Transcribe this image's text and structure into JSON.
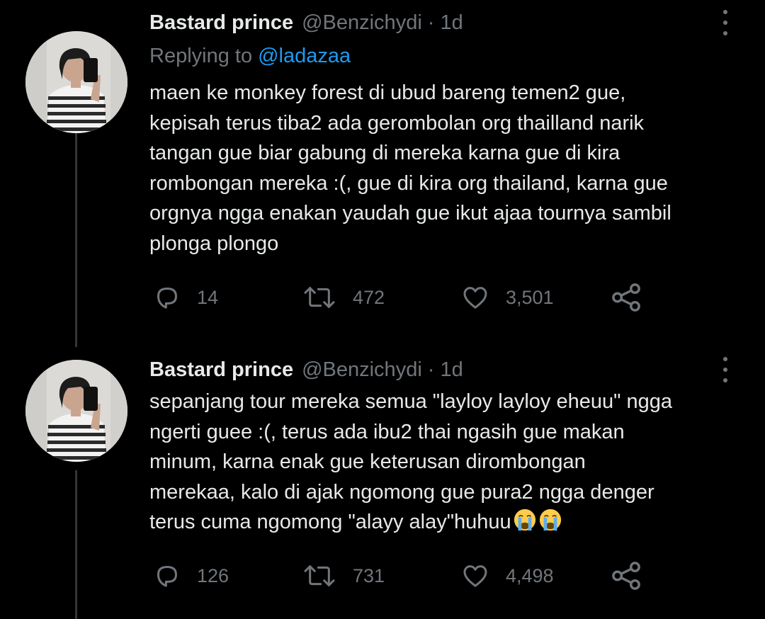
{
  "colors": {
    "background": "#000000",
    "text_primary": "#e7e9ea",
    "text_secondary": "#71767b",
    "link": "#1d9bf0",
    "thread_line": "#333639"
  },
  "tweets": [
    {
      "author_name": "Bastard prince",
      "author_handle": "@Benzichydi",
      "separator": "·",
      "time": "1d",
      "reply_prefix": "Replying to",
      "reply_handle": "@ladazaa",
      "lines": [
        "maen ke monkey forest di ubud bareng temen2 gue,",
        "kepisah terus tiba2 ada gerombolan org thailland narik",
        "tangan gue biar gabung di mereka karna gue di kira",
        "rombongan mereka :(, gue di kira org thailand, karna gue",
        "orgnya ngga enakan yaudah gue ikut ajaa tournya sambil",
        "plonga plongo"
      ],
      "actions": {
        "replies": "14",
        "retweets": "472",
        "likes": "3,501"
      },
      "icons": [
        "avatar",
        "more-icon",
        "reply-icon",
        "retweet-icon",
        "like-icon",
        "share-icon"
      ]
    },
    {
      "author_name": "Bastard prince",
      "author_handle": "@Benzichydi",
      "separator": "·",
      "time": "1d",
      "lines": [
        "sepanjang tour mereka semua \"layloy layloy eheuu\" ngga",
        "ngerti guee :(, terus ada ibu2 thai ngasih gue makan",
        "minum, karna enak gue keterusan dirombongan",
        "merekaa, kalo di ajak ngomong gue pura2 ngga denger",
        "terus cuma ngomong \"alayy alay\"huhuu"
      ],
      "trailing_emoji": [
        "loudly-crying-face-emoji",
        "loudly-crying-face-emoji"
      ],
      "actions": {
        "replies": "126",
        "retweets": "731",
        "likes": "4,498"
      },
      "icons": [
        "avatar",
        "more-icon",
        "reply-icon",
        "retweet-icon",
        "like-icon",
        "share-icon"
      ]
    }
  ]
}
